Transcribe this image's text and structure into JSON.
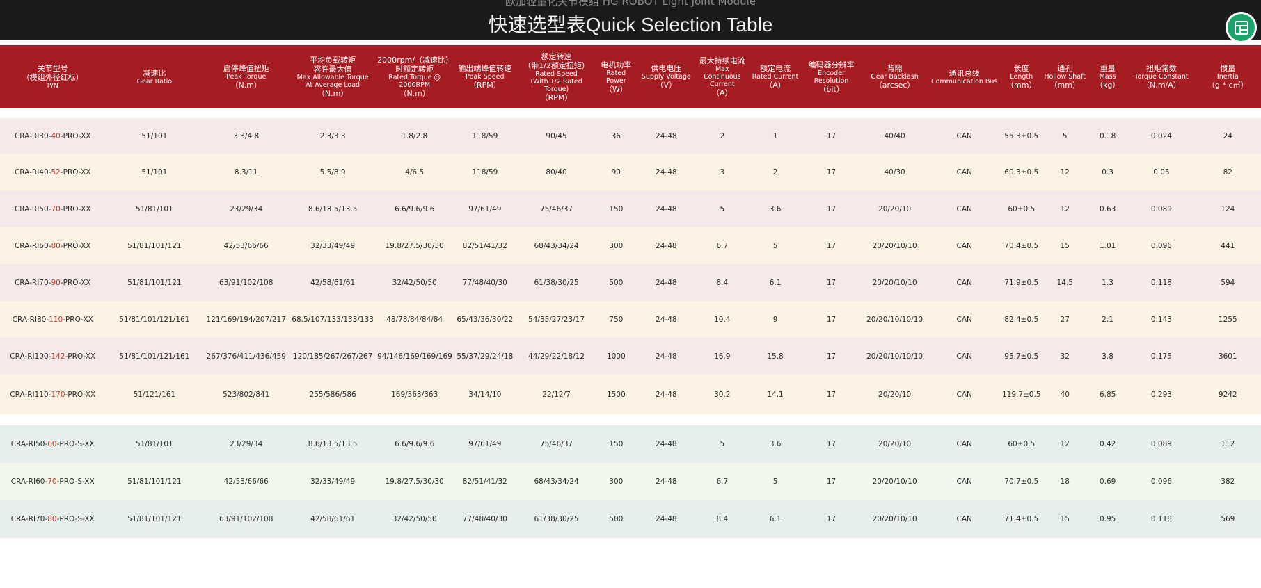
{
  "header": {
    "subtitle": "欧加轻量化关节模组 HG ROBOT Light Joint Module",
    "title": "快速选型表Quick Selection Table",
    "corner_icon": "table-icon",
    "accent_color": "#a51d23"
  },
  "columns": [
    {
      "cn": "关节型号",
      "cn2": "（模组外径红标）",
      "en": "P/N"
    },
    {
      "cn": "减速比",
      "cn2": "",
      "en": "Gear Ratio"
    },
    {
      "cn": "启停峰值扭矩",
      "cn2": "",
      "en": "Peak Torque",
      "unit": "（N.m）"
    },
    {
      "cn": "平均负载转矩",
      "cn2": "容许最大值",
      "en": "Max Allowable Torque",
      "en2": "At Average Load",
      "unit": "（N.m）"
    },
    {
      "cn": "2000rpm/（减速比）",
      "cn2": "时额定转矩",
      "en": "Rated Torque @ 2000RPM",
      "unit": "（N.m）"
    },
    {
      "cn": "输出端峰值转速",
      "cn2": "",
      "en": "Peak Speed",
      "unit": "（RPM）"
    },
    {
      "cn": "额定转速",
      "cn2": "（带1/2额定扭矩）",
      "en": "Rated Speed",
      "en2": "(With 1/2 Rated Torque)",
      "unit": "（RPM）"
    },
    {
      "cn": "电机功率",
      "cn2": "",
      "en": "Rated Power",
      "unit": "（W）"
    },
    {
      "cn": "供电电压",
      "cn2": "",
      "en": "Supply Voltage",
      "unit": "（V）"
    },
    {
      "cn": "最大持续电流",
      "cn2": "",
      "en": "Max Continuous",
      "en2": "Current",
      "unit": "（A）"
    },
    {
      "cn": "额定电流",
      "cn2": "",
      "en": "Rated Current",
      "unit": "（A）"
    },
    {
      "cn": "编码器分辨率",
      "cn2": "",
      "en": "Encoder Resolution",
      "unit": "（bit）"
    },
    {
      "cn": "背隙",
      "cn2": "",
      "en": "Gear Backlash",
      "unit": "（arcsec）"
    },
    {
      "cn": "通讯总线",
      "cn2": "",
      "en": "Communication Bus"
    },
    {
      "cn": "长度",
      "cn2": "",
      "en": "Length",
      "unit": "（mm）"
    },
    {
      "cn": "通孔",
      "cn2": "",
      "en": "Hollow Shaft",
      "unit": "（mm）"
    },
    {
      "cn": "重量",
      "cn2": "",
      "en": "Mass",
      "unit": "（kg）"
    },
    {
      "cn": "扭矩常数",
      "cn2": "",
      "en": "Torque Constant",
      "unit": "（N.m/A）"
    },
    {
      "cn": "惯量",
      "cn2": "",
      "en": "Inertia",
      "unit": "（g * c㎡）"
    }
  ],
  "rows": [
    {
      "pn": [
        "CRA-RI30-",
        "40",
        "-PRO-XX"
      ],
      "cells": [
        "51/101",
        "3.3/4.8",
        "2.3/3.3",
        "1.8/2.8",
        "118/59",
        "90/45",
        "36",
        "24-48",
        "2",
        "1",
        "17",
        "40/40",
        "CAN",
        "55.3±0.5",
        "5",
        "0.18",
        "0.024",
        "24"
      ]
    },
    {
      "pn": [
        "CRA-RI40-",
        "52",
        "-PRO-XX"
      ],
      "cells": [
        "51/101",
        "8.3/11",
        "5.5/8.9",
        "4/6.5",
        "118/59",
        "80/40",
        "90",
        "24-48",
        "3",
        "2",
        "17",
        "40/30",
        "CAN",
        "60.3±0.5",
        "12",
        "0.3",
        "0.05",
        "82"
      ]
    },
    {
      "pn": [
        "CRA-RI50-",
        "70",
        "-PRO-XX"
      ],
      "cells": [
        "51/81/101",
        "23/29/34",
        "8.6/13.5/13.5",
        "6.6/9.6/9.6",
        "97/61/49",
        "75/46/37",
        "150",
        "24-48",
        "5",
        "3.6",
        "17",
        "20/20/10",
        "CAN",
        "60±0.5",
        "12",
        "0.63",
        "0.089",
        "124"
      ]
    },
    {
      "pn": [
        "CRA-RI60-",
        "80",
        "-PRO-XX"
      ],
      "cells": [
        "51/81/101/121",
        "42/53/66/66",
        "32/33/49/49",
        "19.8/27.5/30/30",
        "82/51/41/32",
        "68/43/34/24",
        "300",
        "24-48",
        "6.7",
        "5",
        "17",
        "20/20/10/10",
        "CAN",
        "70.4±0.5",
        "15",
        "1.01",
        "0.096",
        "441"
      ]
    },
    {
      "pn": [
        "CRA-RI70-",
        "90",
        "-PRO-XX"
      ],
      "cells": [
        "51/81/101/121",
        "63/91/102/108",
        "42/58/61/61",
        "32/42/50/50",
        "77/48/40/30",
        "61/38/30/25",
        "500",
        "24-48",
        "8.4",
        "6.1",
        "17",
        "20/20/10/10",
        "CAN",
        "71.9±0.5",
        "14.5",
        "1.3",
        "0.118",
        "594"
      ]
    },
    {
      "pn": [
        "CRA-RI80-",
        "110",
        "-PRO-XX"
      ],
      "cells": [
        "51/81/101/121/161",
        "121/169/194/207/217",
        "68.5/107/133/133/133",
        "48/78/84/84/84",
        "65/43/36/30/22",
        "54/35/27/23/17",
        "750",
        "24-48",
        "10.4",
        "9",
        "17",
        "20/20/10/10/10",
        "CAN",
        "82.4±0.5",
        "27",
        "2.1",
        "0.143",
        "1255"
      ]
    },
    {
      "pn": [
        "CRA-RI100-",
        "142",
        "-PRO-XX"
      ],
      "cells": [
        "51/81/101/121/161",
        "267/376/411/436/459",
        "120/185/267/267/267",
        "94/146/169/169/169",
        "55/37/29/24/18",
        "44/29/22/18/12",
        "1000",
        "24-48",
        "16.9",
        "15.8",
        "17",
        "20/20/10/10/10",
        "CAN",
        "95.7±0.5",
        "32",
        "3.8",
        "0.175",
        "3601"
      ]
    },
    {
      "pn": [
        "CRA-RI110-",
        "170",
        "-PRO-XX"
      ],
      "cells": [
        "51/121/161",
        "523/802/841",
        "255/586/586",
        "169/363/363",
        "34/14/10",
        "22/12/7",
        "1500",
        "24-48",
        "30.2",
        "14.1",
        "17",
        "20/20/10",
        "CAN",
        "119.7±0.5",
        "40",
        "6.85",
        "0.293",
        "9242"
      ]
    }
  ],
  "rows_s": [
    {
      "pn": [
        "CRA-RI50-",
        "60",
        "-PRO-S-XX"
      ],
      "cells": [
        "51/81/101",
        "23/29/34",
        "8.6/13.5/13.5",
        "6.6/9.6/9.6",
        "97/61/49",
        "75/46/37",
        "150",
        "24-48",
        "5",
        "3.6",
        "17",
        "20/20/10",
        "CAN",
        "60±0.5",
        "12",
        "0.42",
        "0.089",
        "112"
      ]
    },
    {
      "pn": [
        "CRA-RI60-",
        "70",
        "-PRO-S-XX"
      ],
      "cells": [
        "51/81/101/121",
        "42/53/66/66",
        "32/33/49/49",
        "19.8/27.5/30/30",
        "82/51/41/32",
        "68/43/34/24",
        "300",
        "24-48",
        "6.7",
        "5",
        "17",
        "20/20/10/10",
        "CAN",
        "70.7±0.5",
        "18",
        "0.69",
        "0.096",
        "382"
      ]
    },
    {
      "pn": [
        "CRA-RI70-",
        "80",
        "-PRO-S-XX"
      ],
      "cells": [
        "51/81/101/121",
        "63/91/102/108",
        "42/58/61/61",
        "32/42/50/50",
        "77/48/40/30",
        "61/38/30/25",
        "500",
        "24-48",
        "8.4",
        "6.1",
        "17",
        "20/20/10/10",
        "CAN",
        "71.4±0.5",
        "15",
        "0.95",
        "0.118",
        "569"
      ]
    }
  ]
}
